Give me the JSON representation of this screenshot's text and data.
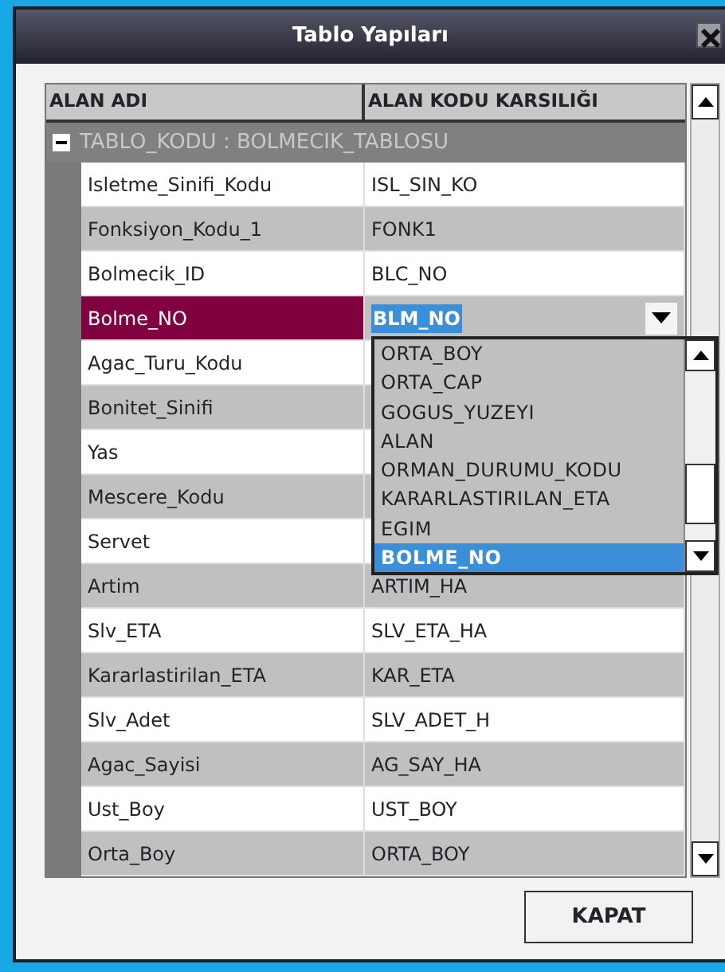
{
  "window": {
    "title": "Tablo Yapıları"
  },
  "columns": [
    "ALAN ADI",
    "ALAN KODU KARSILIĞI"
  ],
  "group": {
    "expanded": true,
    "label": "TABLO_KODU : BOLMECIK_TABLOSU"
  },
  "rows": [
    {
      "name": "Isletme_Sinifi_Kodu",
      "code": "ISL_SIN_KO",
      "selected": false
    },
    {
      "name": "Fonksiyon_Kodu_1",
      "code": "FONK1",
      "selected": false
    },
    {
      "name": "Bolmecik_ID",
      "code": "BLC_NO",
      "selected": false
    },
    {
      "name": "Bolme_NO",
      "code": "BLM_NO",
      "selected": true
    },
    {
      "name": "Agac_Turu_Kodu",
      "selected": false
    },
    {
      "name": "Bonitet_Sinifi",
      "selected": false
    },
    {
      "name": "Yas",
      "selected": false
    },
    {
      "name": "Mescere_Kodu",
      "selected": false
    },
    {
      "name": "Servet",
      "selected": false
    },
    {
      "name": "Artim",
      "code": "ARTIM_HA",
      "selected": false
    },
    {
      "name": "Slv_ETA",
      "code": "SLV_ETA_HA",
      "selected": false
    },
    {
      "name": "Kararlastirilan_ETA",
      "code": "KAR_ETA",
      "selected": false
    },
    {
      "name": "Slv_Adet",
      "code": "SLV_ADET_H",
      "selected": false
    },
    {
      "name": "Agac_Sayisi",
      "code": "AG_SAY_HA",
      "selected": false
    },
    {
      "name": "Ust_Boy",
      "code": "UST_BOY",
      "selected": false
    },
    {
      "name": "Orta_Boy",
      "code": "ORTA_BOY",
      "selected": false
    }
  ],
  "dropdown": {
    "items": [
      {
        "label": "ORTA_BOY",
        "selected": false
      },
      {
        "label": "ORTA_CAP",
        "selected": false
      },
      {
        "label": "GOGUS_YUZEYI",
        "selected": false
      },
      {
        "label": "ALAN",
        "selected": false
      },
      {
        "label": "ORMAN_DURUMU_KODU",
        "selected": false
      },
      {
        "label": "KARARLASTIRILAN_ETA",
        "selected": false
      },
      {
        "label": "EGIM",
        "selected": false
      },
      {
        "label": "BOLME_NO",
        "selected": true
      }
    ]
  },
  "buttons": [
    "KAPAT"
  ]
}
